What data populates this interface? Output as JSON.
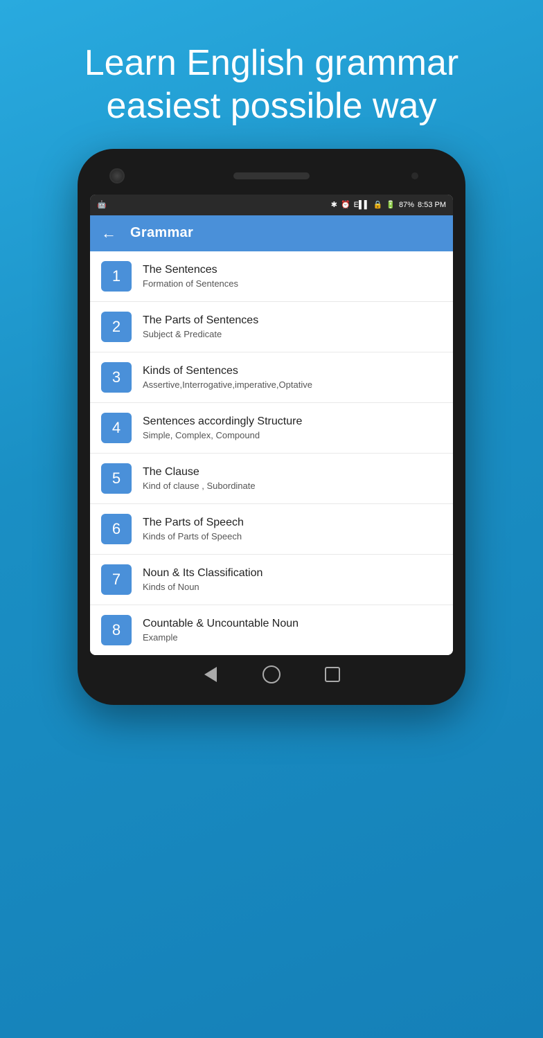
{
  "hero": {
    "line1": "Learn English grammar",
    "line2": "easiest possible way"
  },
  "status_bar": {
    "battery": "87%",
    "time": "8:53 PM",
    "bluetooth": "✱",
    "clock": "⏰",
    "signal": "E▌▌",
    "battery_icon": "🔋"
  },
  "app_bar": {
    "title": "Grammar",
    "back_label": "←"
  },
  "items": [
    {
      "number": "1",
      "title": "The Sentences",
      "subtitle": "Formation of Sentences"
    },
    {
      "number": "2",
      "title": "The Parts of Sentences",
      "subtitle": "Subject & Predicate"
    },
    {
      "number": "3",
      "title": "Kinds of Sentences",
      "subtitle": "Assertive,Interrogative,imperative,Optative"
    },
    {
      "number": "4",
      "title": "Sentences accordingly Structure",
      "subtitle": "Simple, Complex, Compound"
    },
    {
      "number": "5",
      "title": "The Clause",
      "subtitle": "Kind of clause , Subordinate"
    },
    {
      "number": "6",
      "title": "The Parts of Speech",
      "subtitle": "Kinds of Parts of Speech"
    },
    {
      "number": "7",
      "title": "Noun & Its Classification",
      "subtitle": "Kinds of Noun"
    },
    {
      "number": "8",
      "title": "Countable & Uncountable Noun",
      "subtitle": "Example"
    }
  ]
}
